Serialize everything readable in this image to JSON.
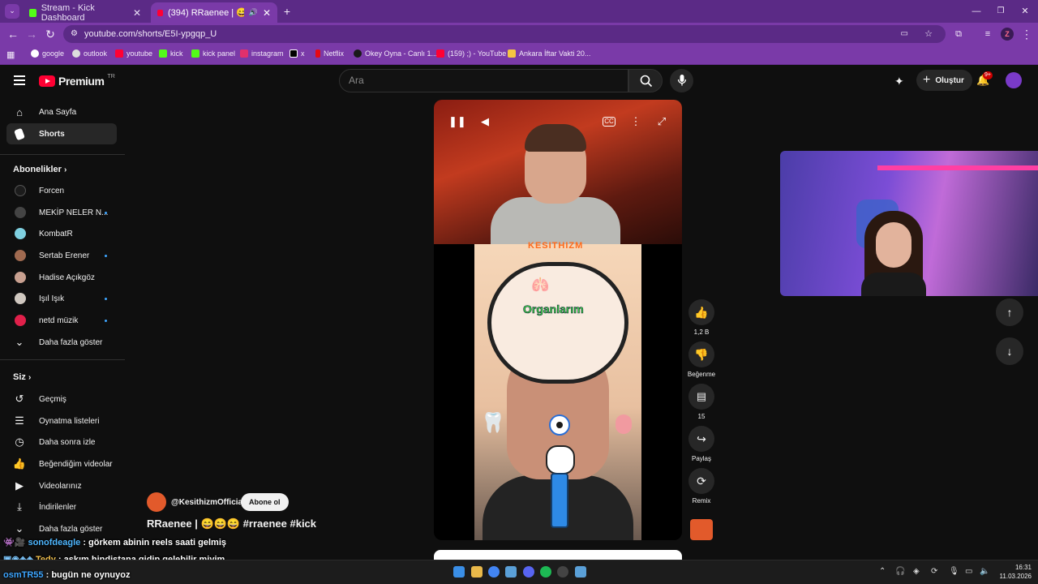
{
  "browser": {
    "tabs": [
      {
        "title": "Stream - Kick Dashboard",
        "active": false
      },
      {
        "title": "(394) RRaenee | 😄😄😄 #",
        "active": true
      }
    ],
    "url": "youtube.com/shorts/E5I-ypgqp_U",
    "bookmarks": [
      "google",
      "outlook",
      "youtube",
      "kick",
      "kick panel",
      "instagram",
      "x",
      "Netflix",
      "Okey Oyna - Canlı 1...",
      "(159) ;) - YouTube",
      "Ankara İftar Vakti 20..."
    ],
    "profile_initial": "Z"
  },
  "yt": {
    "logo_text": "Premium",
    "logo_region": "TR",
    "search_placeholder": "Ara",
    "create_label": "Oluştur",
    "notif_count": "9+"
  },
  "sidebar": {
    "top_items": [
      {
        "label": "Ana Sayfa",
        "icon": "home-icon"
      },
      {
        "label": "Shorts",
        "icon": "shorts-icon",
        "active": true
      }
    ],
    "subs_heading": "Abonelikler",
    "subscriptions": [
      {
        "label": "Forcen",
        "new": false,
        "color": "#1c1c1c"
      },
      {
        "label": "MEKİP NELER N...",
        "new": true,
        "color": "#444"
      },
      {
        "label": "KombatR",
        "new": false,
        "color": "#7fd0e0"
      },
      {
        "label": "Sertab Erener",
        "new": true,
        "color": "#a06a50"
      },
      {
        "label": "Hadise Açıkgöz",
        "new": false,
        "color": "#c8a090"
      },
      {
        "label": "Işıl Işık",
        "new": true,
        "color": "#d0c8c0"
      },
      {
        "label": "netd müzik",
        "new": true,
        "color": "#e0204a"
      }
    ],
    "show_more": "Daha fazla göster",
    "you_heading": "Siz",
    "you_items": [
      {
        "label": "Geçmiş",
        "icon": "history-icon"
      },
      {
        "label": "Oynatma listeleri",
        "icon": "playlists-icon"
      },
      {
        "label": "Daha sonra izle",
        "icon": "watch-later-icon"
      },
      {
        "label": "Beğendiğim videolar",
        "icon": "liked-videos-icon"
      },
      {
        "label": "Videolarınız",
        "icon": "your-videos-icon"
      },
      {
        "label": "İndirilenler",
        "icon": "downloads-icon"
      }
    ],
    "show_more_2": "Daha fazla göster"
  },
  "video": {
    "game_banner": "KESITHIZM",
    "game_title": "Organlarım"
  },
  "actions": {
    "like_count": "1,2 B",
    "dislike_label": "Beğenme",
    "comment_count": "15",
    "share_label": "Paylaş",
    "remix_label": "Remix"
  },
  "channel": {
    "handle": "@KesithizmOfficial",
    "subscribe_label": "Abone ol",
    "title": "RRaenee | 😄😄😄 #rraenee #kick"
  },
  "chat": [
    {
      "user": "sonofdeagle",
      "user_color": "#4fb7ff",
      "message": "görkem abinin reels saati gelmiş"
    },
    {
      "user": "Tedy",
      "user_color": "#f2c14e",
      "message": "aşkım hindistana gidip gelebilir miyim"
    },
    {
      "user": "osmTR55",
      "user_color": "#3ea6ff",
      "message": "bugün ne oynuyoz"
    }
  ],
  "taskbar": {
    "time": "16:31",
    "date": "11.03.2026"
  }
}
